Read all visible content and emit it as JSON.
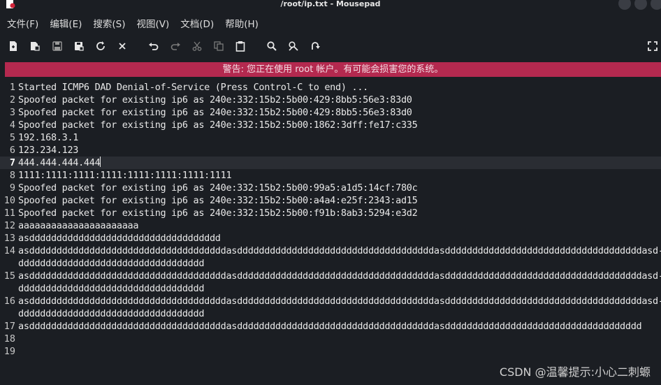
{
  "window": {
    "title": "/root/ip.txt - Mousepad"
  },
  "menu": [
    "文件(F)",
    "编辑(E)",
    "搜索(S)",
    "视图(V)",
    "文档(D)",
    "帮助(H)"
  ],
  "toolbar": {
    "icons": [
      "new-document-icon",
      "new-window-icon",
      "save-icon",
      "save-as-icon",
      "reload-icon",
      "close-icon",
      "undo-icon",
      "redo-icon",
      "cut-icon",
      "copy-icon",
      "paste-icon",
      "find-icon",
      "find-replace-icon",
      "go-to-icon",
      "fullscreen-icon"
    ]
  },
  "warning": "警告: 您正在使用 root 帐户。有可能会损害您的系统。",
  "editor": {
    "current_line": 7,
    "lines": [
      {
        "n": "1",
        "text": "Started ICMP6 DAD Denial-of-Service (Press Control-C to end) ..."
      },
      {
        "n": "2",
        "text": "Spoofed packet for existing ip6 as 240e:332:15b2:5b00:429:8bb5:56e3:83d0"
      },
      {
        "n": "3",
        "text": "Spoofed packet for existing ip6 as 240e:332:15b2:5b00:429:8bb5:56e3:83d0"
      },
      {
        "n": "4",
        "text": "Spoofed packet for existing ip6 as 240e:332:15b2:5b00:1862:3dff:fe17:c335"
      },
      {
        "n": "5",
        "text": "192.168.3.1"
      },
      {
        "n": "6",
        "text": "123.234.123"
      },
      {
        "n": "7",
        "text": "444.444.444.444"
      },
      {
        "n": "8",
        "text": "1111:1111:1111:1111:1111:1111:1111:1111"
      },
      {
        "n": "9",
        "text": "Spoofed packet for existing ip6 as 240e:332:15b2:5b00:99a5:a1d5:14cf:780c"
      },
      {
        "n": "10",
        "text": "Spoofed packet for existing ip6 as 240e:332:15b2:5b00:a4a4:e25f:2343:ad15"
      },
      {
        "n": "11",
        "text": "Spoofed packet for existing ip6 as 240e:332:15b2:5b00:f91b:8ab3:5294:e3d2"
      },
      {
        "n": "12",
        "text": "aaaaaaaaaaaaaaaaaaaaaa"
      },
      {
        "n": "13",
        "text": "asddddddddddddddddddddddddddddddddddd"
      },
      {
        "n": "14",
        "text": "asddddddddddddddddddddddddddddddddddddasddddddddddddddddddddddddddddddddddddasddddddddddddddddddddddddddddddddddddasd-"
      },
      {
        "n": "",
        "text": "dddddddddddddddddddddddddddddddddd"
      },
      {
        "n": "15",
        "text": "asddddddddddddddddddddddddddddddddddddasddddddddddddddddddddddddddddddddddddasddddddddddddddddddddddddddddddddddddasd-"
      },
      {
        "n": "",
        "text": "dddddddddddddddddddddddddddddddddd"
      },
      {
        "n": "16",
        "text": "asddddddddddddddddddddddddddddddddddddasddddddddddddddddddddddddddddddddddddasddddddddddddddddddddddddddddddddddddasd-"
      },
      {
        "n": "",
        "text": "dddddddddddddddddddddddddddddddddd"
      },
      {
        "n": "17",
        "text": "asddddddddddddddddddddddddddddddddddddasddddddddddddddddddddddddddddddddddddasdddddddddddddddddddddddddddddddddddd"
      },
      {
        "n": "18",
        "text": ""
      },
      {
        "n": "19",
        "text": ""
      }
    ]
  },
  "watermark": "CSDN @温馨提示:小心二刺螈"
}
